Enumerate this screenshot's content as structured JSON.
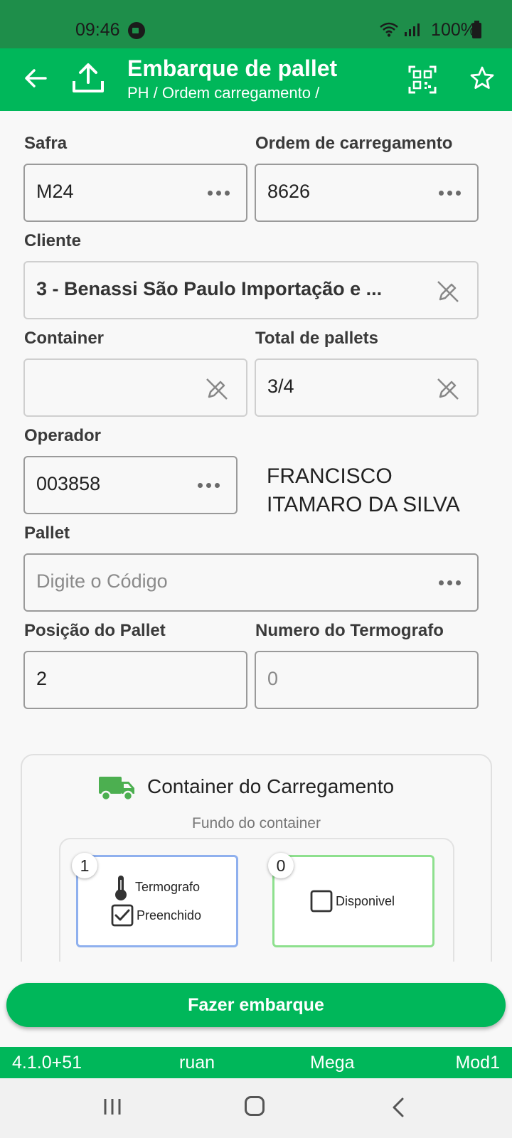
{
  "status_bar": {
    "time": "09:46",
    "battery": "100%"
  },
  "app_bar": {
    "title": "Embarque de pallet",
    "breadcrumb": "PH / Ordem carregamento /"
  },
  "form": {
    "safra": {
      "label": "Safra",
      "value": "M24"
    },
    "ordem": {
      "label": "Ordem de carregamento",
      "value": "8626"
    },
    "cliente": {
      "label": "Cliente",
      "value": "3 - Benassi São Paulo Importação e ..."
    },
    "container": {
      "label": "Container",
      "value": ""
    },
    "total_pallets": {
      "label": "Total de pallets",
      "value": "3/4"
    },
    "operador": {
      "label": "Operador",
      "value": "003858",
      "name_line1": "FRANCISCO",
      "name_line2": "ITAMARO DA SILVA"
    },
    "pallet": {
      "label": "Pallet",
      "placeholder": "Digite o Código"
    },
    "posicao": {
      "label": "Posição do Pallet",
      "value": "2"
    },
    "termografo": {
      "label": "Numero do Termografo",
      "placeholder": "0"
    }
  },
  "container_card": {
    "title": "Container do Carregamento",
    "subtitle": "Fundo do container",
    "slots": [
      {
        "number": "1",
        "line1": "Termografo",
        "line2": "Preenchido",
        "checked": true,
        "color": "#8fb0ee"
      },
      {
        "number": "0",
        "line1": "Disponivel",
        "checked": false,
        "color": "#8ee08e"
      }
    ]
  },
  "action": {
    "label": "Fazer embarque"
  },
  "footer": {
    "version": "4.1.0+51",
    "user": "ruan",
    "company": "Mega",
    "module": "Mod1"
  },
  "colors": {
    "primary": "#00b75a",
    "status_bar": "#1e8e4a"
  }
}
